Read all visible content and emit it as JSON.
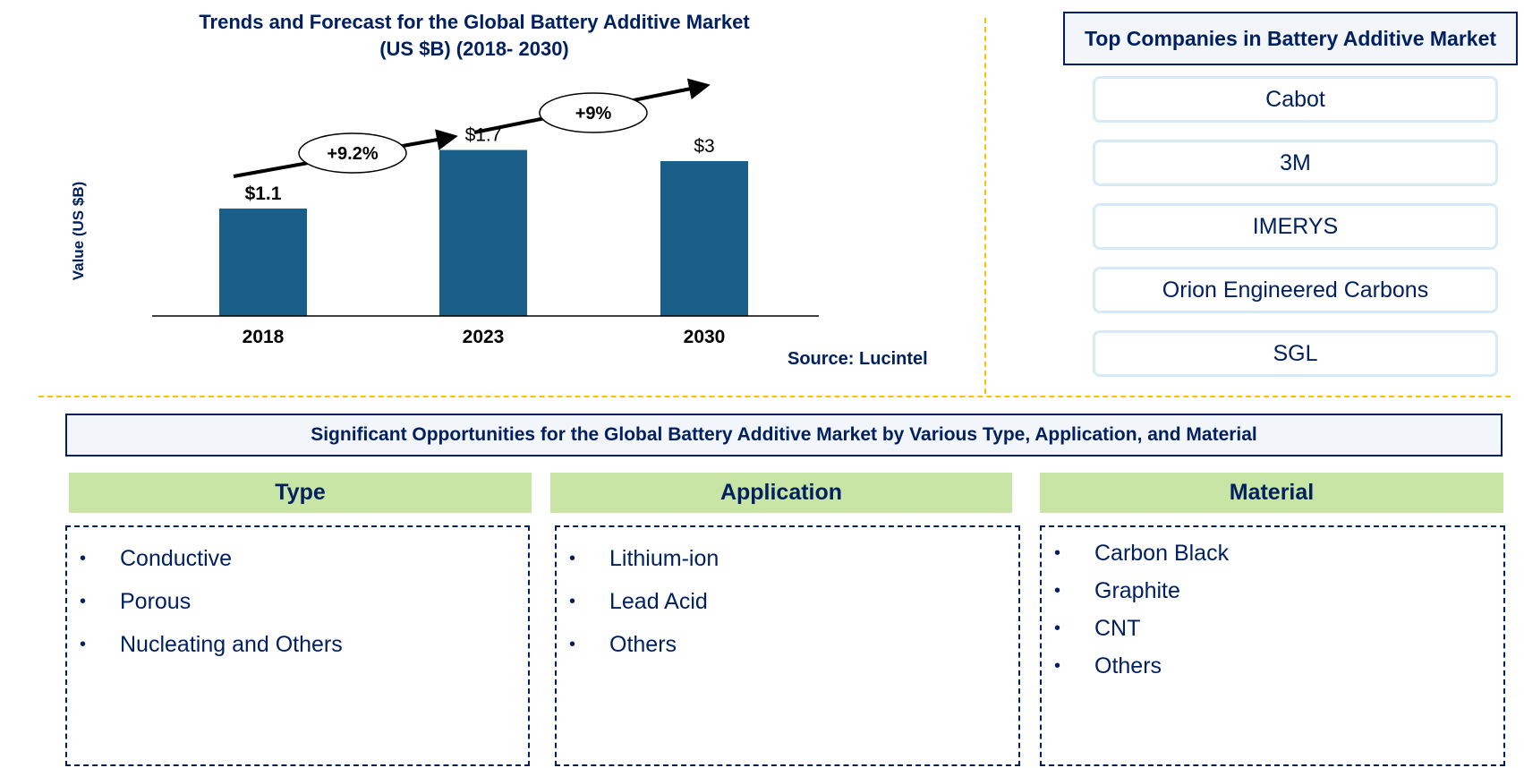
{
  "chart_data": {
    "type": "bar",
    "title": "Trends and Forecast for the Global Battery Additive Market",
    "subtitle": "(US $B) (2018- 2030)",
    "xlabel": "",
    "ylabel": "Value (US $B)",
    "categories": [
      "2018",
      "2023",
      "2030"
    ],
    "values": [
      1.1,
      1.7,
      3.0
    ],
    "data_labels": [
      "$1.1",
      "$1.7",
      "$3"
    ],
    "ylim": [
      0,
      3.5
    ],
    "grid": false,
    "bar_color": "#1a5f8a",
    "annotations": [
      {
        "label": "+9.2%",
        "from": "2018",
        "to": "2023",
        "type": "CAGR arrow"
      },
      {
        "label": "+9%",
        "from": "2023",
        "to": "2030",
        "type": "CAGR arrow"
      }
    ],
    "source": "Source: Lucintel"
  },
  "top_companies": {
    "title": "Top Companies in Battery Additive Market",
    "items": [
      "Cabot",
      "3M",
      "IMERYS",
      "Orion Engineered Carbons",
      "SGL"
    ]
  },
  "opportunities": {
    "banner": "Significant Opportunities for the Global Battery Additive Market by Various Type, Application, and Material",
    "columns": [
      {
        "title": "Type",
        "items": [
          "Conductive",
          "Porous",
          "Nucleating and Others"
        ]
      },
      {
        "title": "Application",
        "items": [
          "Lithium-ion",
          "Lead Acid",
          "Others"
        ]
      },
      {
        "title": "Material",
        "items": [
          "Carbon Black",
          "Graphite",
          "CNT",
          "Others"
        ]
      }
    ]
  },
  "colors": {
    "navy": "#002060",
    "bar": "#1a5f8a",
    "divider": "#ffc000",
    "green_header": "#c9e5a6",
    "company_border": "#d6eaf8"
  }
}
